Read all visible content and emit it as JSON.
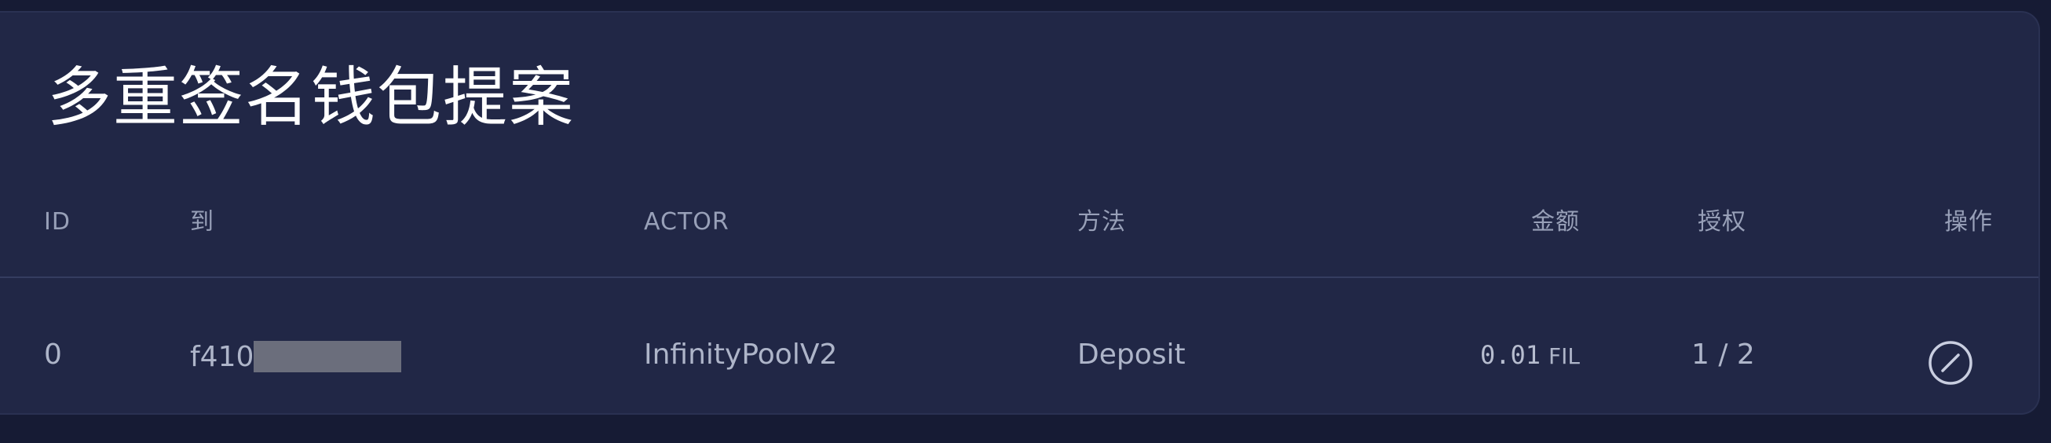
{
  "panel": {
    "title": "多重签名钱包提案"
  },
  "table": {
    "headers": {
      "id": "ID",
      "to": "到",
      "actor": "ACTOR",
      "method": "方法",
      "amount": "金额",
      "approvals": "授权",
      "actions": "操作"
    },
    "rows": [
      {
        "id": "0",
        "to_visible": "f410",
        "actor": "InfinityPoolV2",
        "method": "Deposit",
        "amount_value": "0.01",
        "amount_unit": "FIL",
        "approvals": "1 / 2",
        "action_icon": "cancel-circle-slash-icon"
      }
    ]
  },
  "colors": {
    "background": "#161b34",
    "panel": "#212746",
    "title_text": "#ffffff",
    "header_text": "#98a0b8",
    "cell_text": "#aeb5c9",
    "redaction": "#6b6e7c"
  }
}
